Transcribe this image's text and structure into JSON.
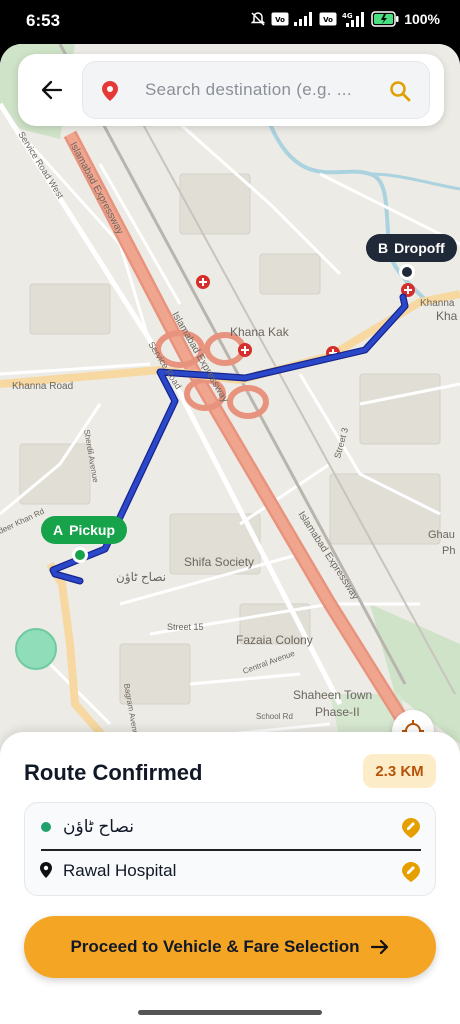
{
  "status_bar": {
    "time": "6:53",
    "battery": "100%",
    "network": "4G",
    "icons": [
      "mute-icon",
      "volte-icon",
      "signal-icon",
      "volte-icon",
      "signal-4g-icon",
      "battery-icon"
    ]
  },
  "search": {
    "placeholder": "Search destination (e.g. ..."
  },
  "map": {
    "labels": {
      "expressway_1": "Islamabad Expressway",
      "expressway_2": "Islamabad Expressway",
      "expressway_3": "Islamabad Expressway",
      "service_road_west": "Service Road West",
      "service_road": "Service Road",
      "khanna_road": "Khanna Road",
      "khanna_road_east": "Khanna",
      "khana_kak": "Khana Kak",
      "shifa_society": "Shifa Society",
      "nasah_town_urdu": "نصاح ٹاؤن",
      "fazaia_colony": "Fazaia Colony",
      "shaheen_town": "Shaheen Town",
      "phase2": "Phase-II",
      "street_15": "Street 15",
      "street_3": "Street 3",
      "central_avenue": "Central Avenue",
      "school_rd": "School Rd",
      "sherdil_avenue": "Sherdil Avenue",
      "bagram_avenue": "Bagram Avenue",
      "deer_khan_rd": "deer Khan Rd",
      "gha": "Ghau",
      "ph": "Ph",
      "kha": "Kha"
    },
    "pickup_marker": {
      "letter": "A",
      "label": "Pickup"
    },
    "dropoff_marker": {
      "letter": "B",
      "label": "Dropoff"
    },
    "route_color": "#2a48c9",
    "pickup_color": "#16a34a",
    "dropoff_color": "#1f2937"
  },
  "sheet": {
    "title": "Route Confirmed",
    "distance": "2.3 KM",
    "pickup_name": "نصاح ٹاؤن",
    "dropoff_name": "Rawal Hospital",
    "proceed_label": "Proceed to Vehicle & Fare Selection",
    "accent": "#f5a524"
  }
}
